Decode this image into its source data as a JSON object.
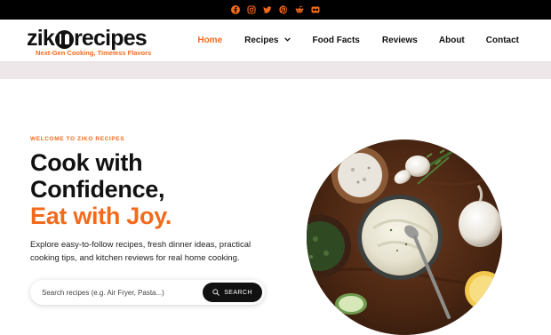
{
  "social": [
    {
      "name": "facebook-icon",
      "color": "#f26b1d"
    },
    {
      "name": "instagram-icon",
      "color": "#f26b1d"
    },
    {
      "name": "twitter-icon",
      "color": "#f26b1d"
    },
    {
      "name": "pinterest-icon",
      "color": "#f26b1d"
    },
    {
      "name": "reddit-icon",
      "color": "#f26b1d"
    },
    {
      "name": "flickr-icon",
      "color": "#f26b1d"
    }
  ],
  "logo": {
    "word_start": "zik",
    "word_end": "recipes",
    "tagline": "Next-Gen Cooking, Timeless Flavors"
  },
  "nav": {
    "home": "Home",
    "recipes": "Recipes",
    "food_facts": "Food Facts",
    "reviews": "Reviews",
    "about": "About",
    "contact": "Contact"
  },
  "hero": {
    "label": "WELCOME TO ZIKO RECIPES",
    "title_line1": "Cook with",
    "title_line2": "Confidence,",
    "title_line3": "Eat with Joy.",
    "description": "Explore easy-to-follow recipes, fresh dinner ideas, practical cooking tips, and kitchen reviews for real home cooking."
  },
  "search": {
    "placeholder": "Search recipes (e.g. Air Fryer, Pasta...)",
    "button_label": "SEARCH"
  },
  "colors": {
    "accent": "#f26b1d",
    "topbar": "#000000",
    "band": "#eee7ea"
  }
}
